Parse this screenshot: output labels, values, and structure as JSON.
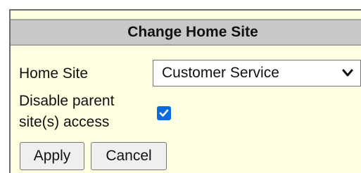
{
  "dialog": {
    "title": "Change Home Site"
  },
  "home_site": {
    "label": "Home Site",
    "selected_value": "Customer Service"
  },
  "disable_parent": {
    "label_line1": "Disable parent",
    "label_line2": "site(s) access",
    "checked": true
  },
  "actions": {
    "apply_label": "Apply",
    "cancel_label": "Cancel"
  },
  "icons": {
    "select_arrow": "chevron-down-icon",
    "checkmark": "check-icon"
  },
  "colors": {
    "panel_background": "#fefee0",
    "title_bar_background": "#c8c8c8",
    "checkbox_accent": "#0a6cdc"
  }
}
